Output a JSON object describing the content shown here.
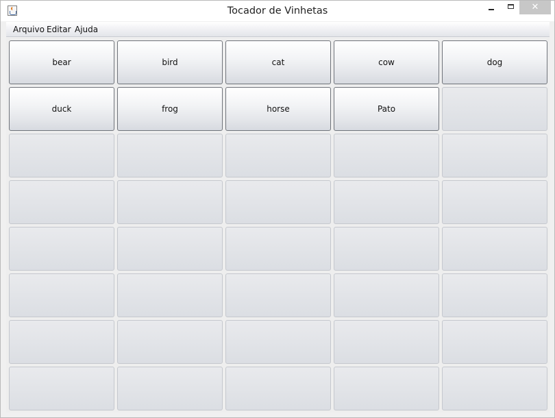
{
  "window": {
    "title": "Tocador de Vinhetas",
    "app_icon": "java-cup-icon",
    "controls": {
      "minimize_icon": "minimize-icon",
      "maximize_icon": "maximize-icon",
      "close_label": "✕"
    }
  },
  "menu": {
    "items": [
      {
        "label": "Arquivo"
      },
      {
        "label": "Editar"
      },
      {
        "label": "Ajuda"
      }
    ]
  },
  "grid": {
    "columns": 5,
    "rows": 8,
    "buttons": [
      {
        "label": "bear"
      },
      {
        "label": "bird"
      },
      {
        "label": "cat"
      },
      {
        "label": "cow"
      },
      {
        "label": "dog"
      },
      {
        "label": "duck"
      },
      {
        "label": "frog"
      },
      {
        "label": "horse"
      },
      {
        "label": "Pato"
      }
    ]
  },
  "colors": {
    "close_button": "#c7c7c7",
    "background": "#eeeeee"
  }
}
